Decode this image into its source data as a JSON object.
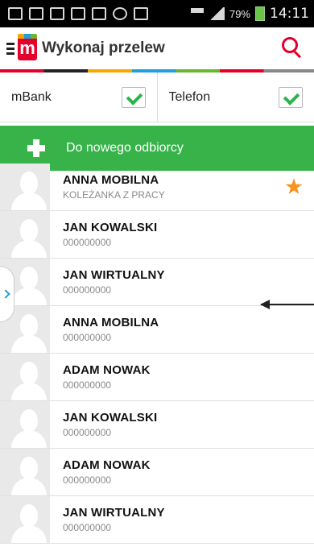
{
  "status_bar": {
    "battery": "79%",
    "time": "14:11"
  },
  "header": {
    "logo_letter": "m",
    "title": "Wykonaj przelew"
  },
  "filters": [
    {
      "label": "mBank",
      "checked": true
    },
    {
      "label": "Telefon",
      "checked": true
    }
  ],
  "new_recipient": {
    "label": "Do nowego odbiorcy"
  },
  "contacts": [
    {
      "name": "ANNA MOBILNA",
      "sub": "KOLEŻANKA Z PRACY",
      "favorite": true
    },
    {
      "name": "JAN KOWALSKI",
      "sub": "000000000",
      "favorite": false
    },
    {
      "name": "JAN WIRTUALNY",
      "sub": "000000000",
      "favorite": false
    },
    {
      "name": "ANNA MOBILNA",
      "sub": "000000000",
      "favorite": false
    },
    {
      "name": "ADAM NOWAK",
      "sub": "000000000",
      "favorite": false
    },
    {
      "name": "JAN KOWALSKI",
      "sub": "000000000",
      "favorite": false
    },
    {
      "name": "ADAM NOWAK",
      "sub": "000000000",
      "favorite": false
    },
    {
      "name": "JAN WIRTUALNY",
      "sub": "000000000",
      "favorite": false
    }
  ],
  "colors": {
    "accent_green": "#37b34a",
    "brand_red": "#e4002b",
    "star_orange": "#f7931e"
  }
}
